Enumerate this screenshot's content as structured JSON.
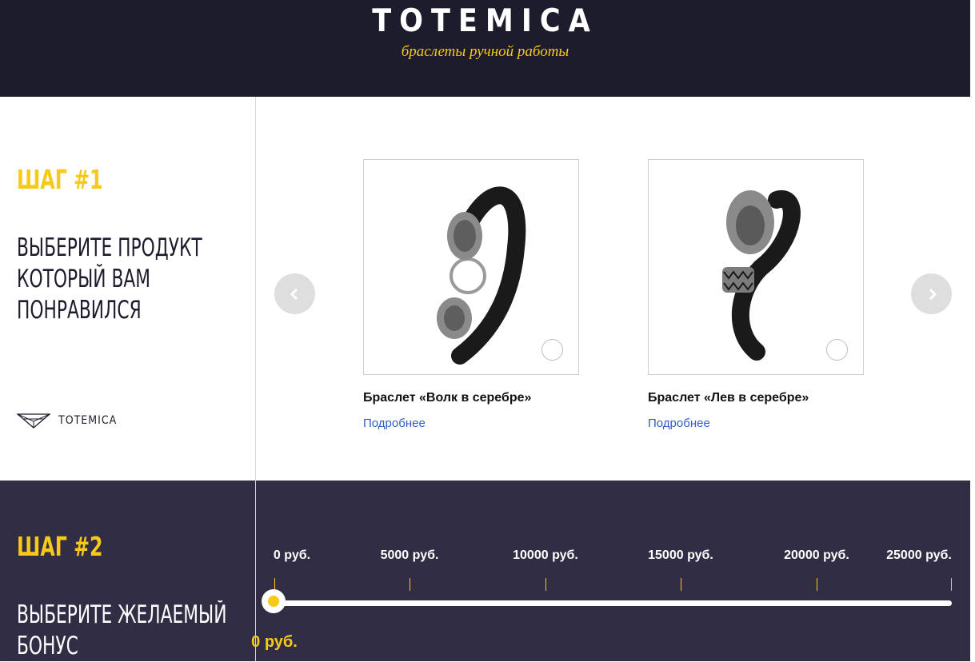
{
  "header": {
    "brand": "TOTEMICA",
    "tagline": "браслеты ручной работы"
  },
  "step1": {
    "title": "ШАГ #1",
    "lines": [
      "ВЫБЕРИТЕ ПРОДУКТ",
      "КОТОРЫЙ ВАМ",
      "ПОНРАВИЛСЯ"
    ],
    "logo_text": "TOTEMICA",
    "products": [
      {
        "name": "Браслет «Волк в серебре»",
        "link": "Подробнее",
        "image_icon": "wolf-bracelet-image"
      },
      {
        "name": "Браслет «Лев в серебре»",
        "link": "Подробнее",
        "image_icon": "lion-bracelet-image"
      }
    ]
  },
  "step2": {
    "title": "ШАГ #2",
    "lines": [
      "ВЫБЕРИТЕ ЖЕЛАЕМЫЙ",
      "БОНУС"
    ],
    "slider": {
      "ticks": [
        "0 руб.",
        "5000 руб.",
        "10000 руб.",
        "15000 руб.",
        "20000 руб.",
        "25000 руб."
      ],
      "value": 0,
      "value_label": "0 руб."
    }
  },
  "colors": {
    "accent": "#f7c919",
    "header_bg": "#1d1c2c",
    "step2_bg": "#312d44",
    "link": "#2f5fc4"
  }
}
